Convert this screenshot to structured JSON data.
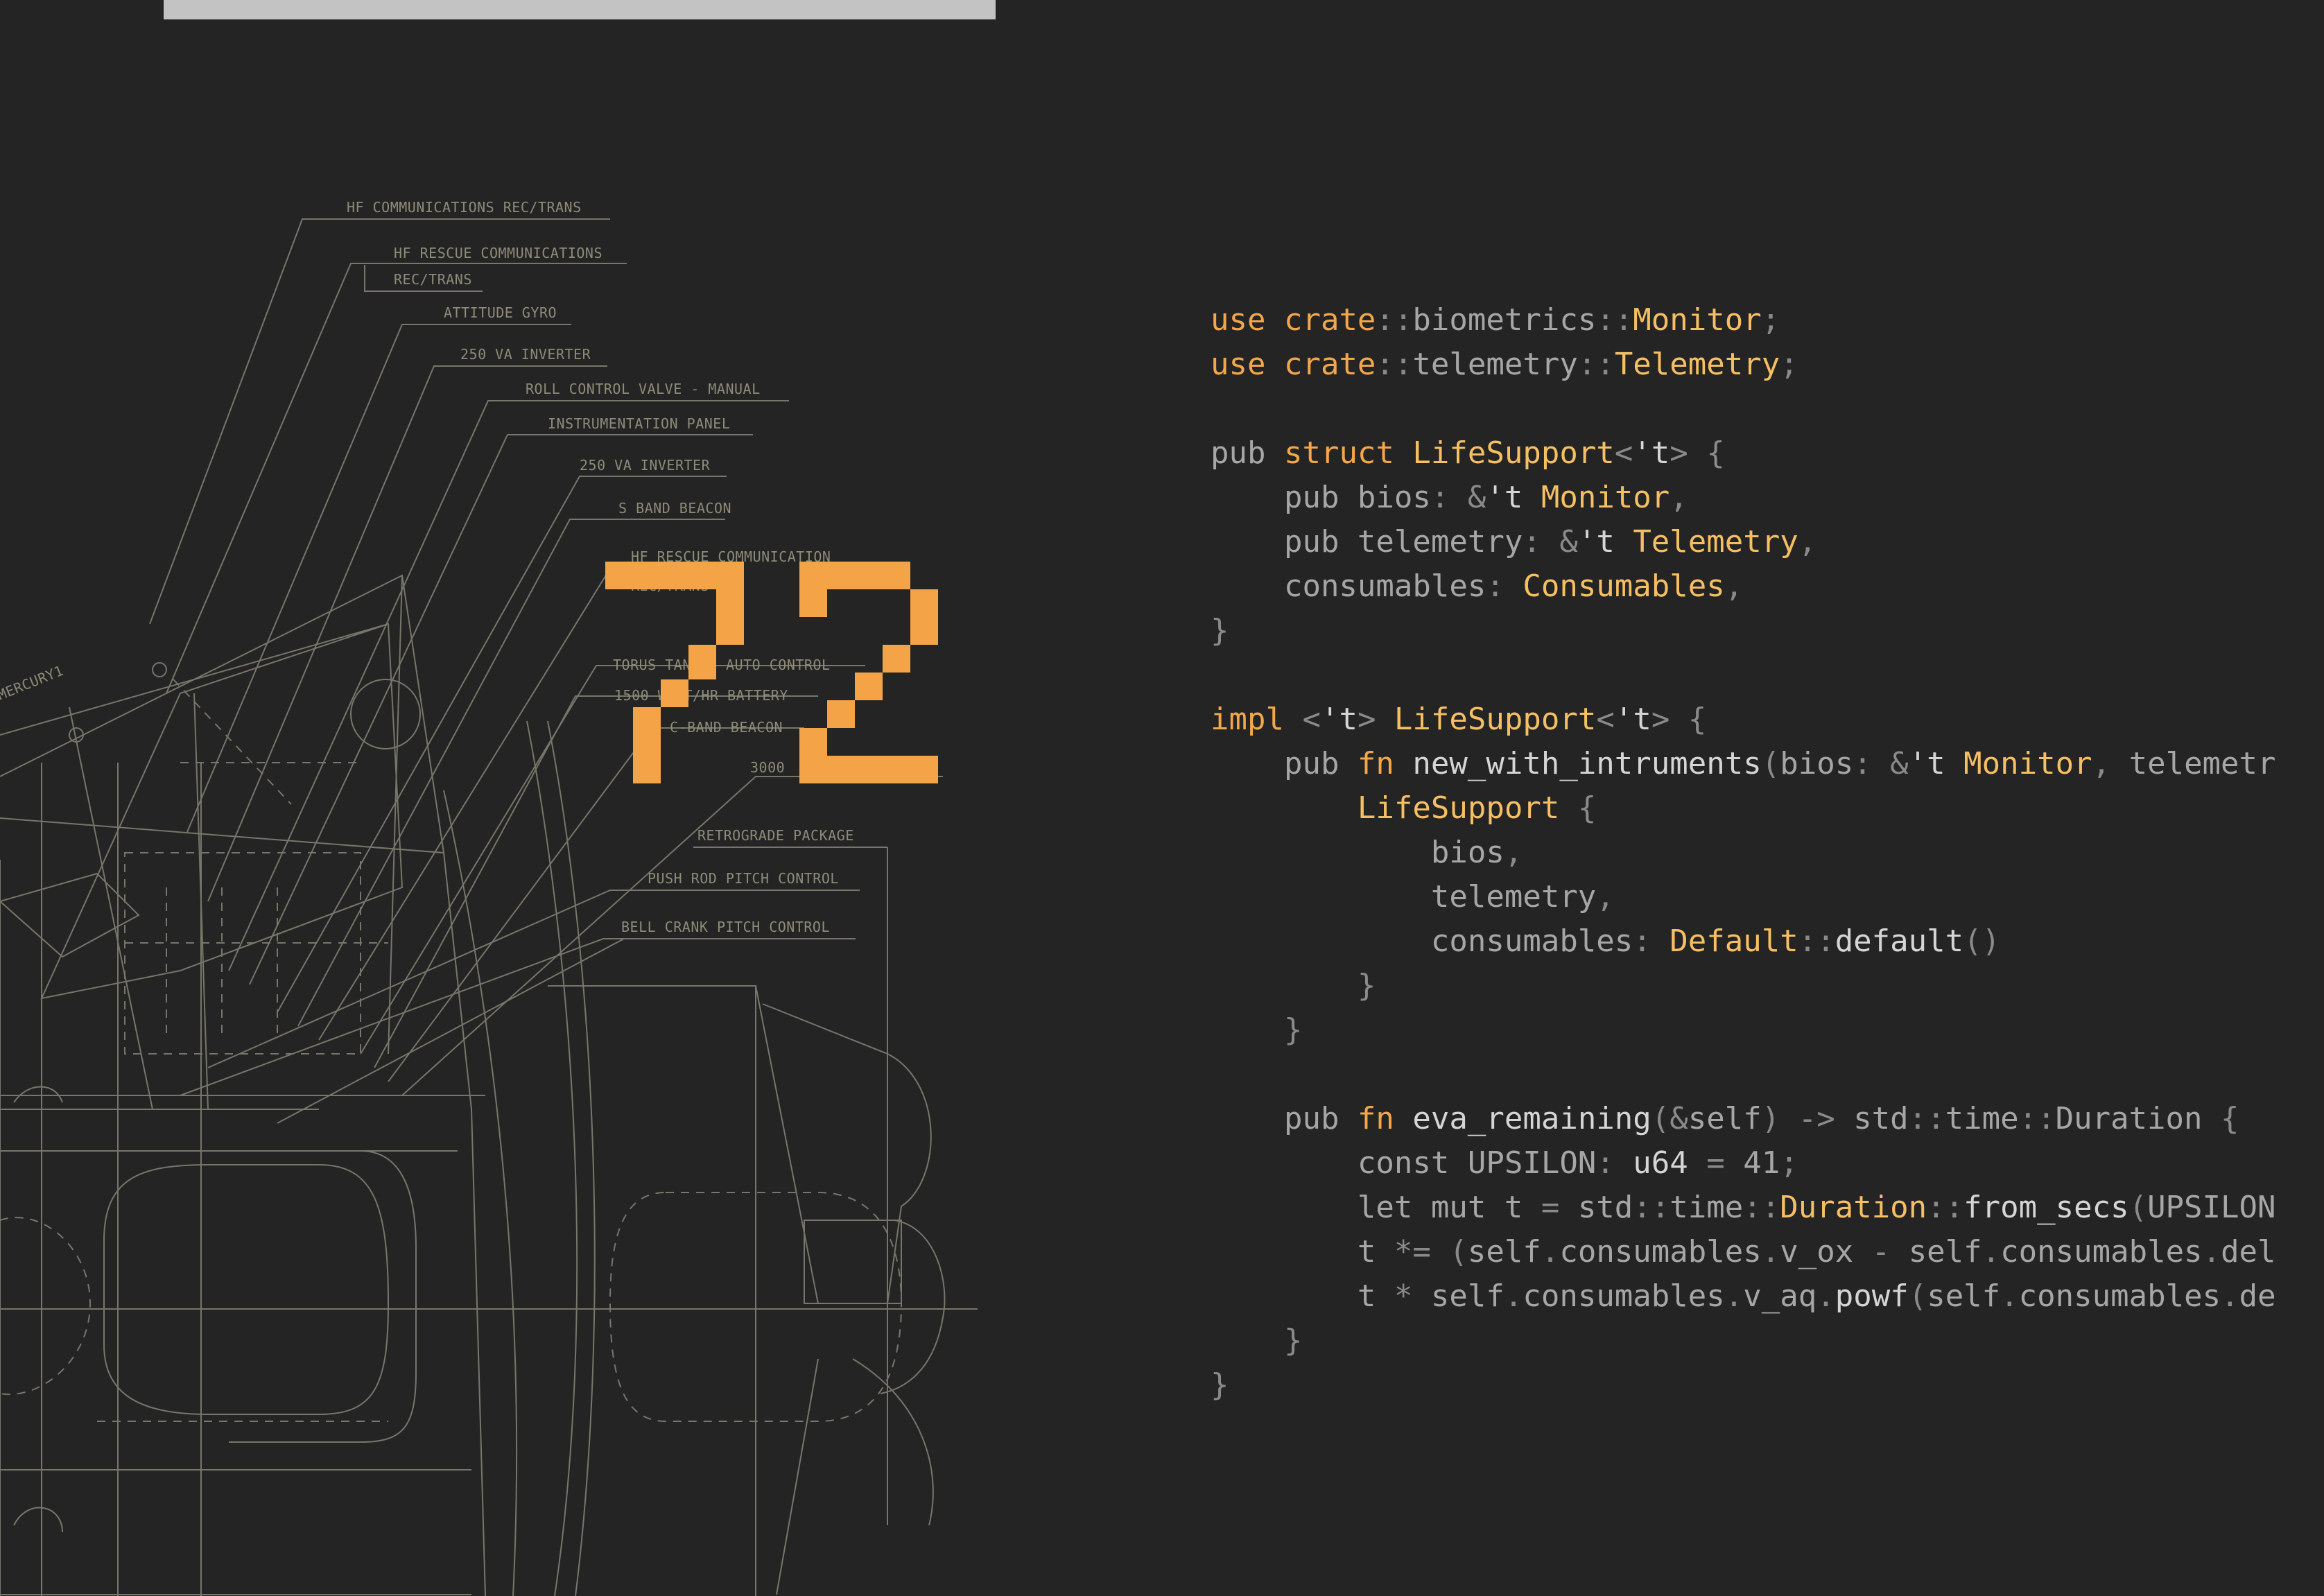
{
  "page": {
    "counter": "72",
    "top_quote_marks": "\" \" \" \""
  },
  "blueprint": {
    "labels": [
      "HF COMMUNICATIONS REC/TRANS",
      "HF RESCUE COMMUNICATIONS",
      "REC/TRANS",
      "ATTITUDE GYRO",
      "250 VA INVERTER",
      "ROLL CONTROL VALVE - MANUAL",
      "INSTRUMENTATION PANEL",
      "250 VA INVERTER",
      "S BAND BEACON",
      "HF RESCUE COMMUNICATION",
      "REC/TRANS",
      "TORUS TANK - AUTO CONTROL",
      "1500 WATT/HR BATTERY",
      "C-BAND BEACON",
      "3000",
      "RETROGRADE PACKAGE",
      "PUSH ROD PITCH CONTROL",
      "BELL CRANK PITCH CONTROL",
      "MERCURY1"
    ]
  },
  "code": {
    "lines": [
      [
        [
          "kw",
          "use "
        ],
        [
          "kw",
          "crate"
        ],
        [
          "pn",
          "::"
        ],
        [
          "tx",
          "biometrics"
        ],
        [
          "pn",
          "::"
        ],
        [
          "ty",
          "Monitor"
        ],
        [
          "pn",
          ";"
        ]
      ],
      [
        [
          "kw",
          "use "
        ],
        [
          "kw",
          "crate"
        ],
        [
          "pn",
          "::"
        ],
        [
          "tx",
          "telemetry"
        ],
        [
          "pn",
          "::"
        ],
        [
          "ty",
          "Telemetry"
        ],
        [
          "pn",
          ";"
        ]
      ],
      [],
      [
        [
          "tx",
          "pub "
        ],
        [
          "kw",
          "struct "
        ],
        [
          "ty",
          "LifeSupport"
        ],
        [
          "pn",
          "<"
        ],
        [
          "fn",
          "'t"
        ],
        [
          "pn",
          "> {"
        ]
      ],
      [
        [
          "tx",
          "    pub bios"
        ],
        [
          "pn",
          ": &"
        ],
        [
          "fn",
          "'t "
        ],
        [
          "ty",
          "Monitor"
        ],
        [
          "pn",
          ","
        ]
      ],
      [
        [
          "tx",
          "    pub telemetry"
        ],
        [
          "pn",
          ": &"
        ],
        [
          "fn",
          "'t "
        ],
        [
          "ty",
          "Telemetry"
        ],
        [
          "pn",
          ","
        ]
      ],
      [
        [
          "tx",
          "    consumables"
        ],
        [
          "pn",
          ": "
        ],
        [
          "ty",
          "Consumables"
        ],
        [
          "pn",
          ","
        ]
      ],
      [
        [
          "pn",
          "}"
        ]
      ],
      [],
      [
        [
          "kw",
          "impl "
        ],
        [
          "pn",
          "<"
        ],
        [
          "fn",
          "'t"
        ],
        [
          "pn",
          "> "
        ],
        [
          "ty",
          "LifeSupport"
        ],
        [
          "pn",
          "<"
        ],
        [
          "fn",
          "'t"
        ],
        [
          "pn",
          "> {"
        ]
      ],
      [
        [
          "tx",
          "    pub "
        ],
        [
          "kw",
          "fn "
        ],
        [
          "fn",
          "new_with_intruments"
        ],
        [
          "pn",
          "("
        ],
        [
          "tx",
          "bios"
        ],
        [
          "pn",
          ": &"
        ],
        [
          "fn",
          "'t "
        ],
        [
          "ty",
          "Monitor"
        ],
        [
          "pn",
          ", "
        ],
        [
          "tx",
          "telemetr"
        ]
      ],
      [
        [
          "tx",
          "        "
        ],
        [
          "ty",
          "LifeSupport"
        ],
        [
          "pn",
          " {"
        ]
      ],
      [
        [
          "tx",
          "            bios"
        ],
        [
          "pn",
          ","
        ]
      ],
      [
        [
          "tx",
          "            telemetry"
        ],
        [
          "pn",
          ","
        ]
      ],
      [
        [
          "tx",
          "            consumables"
        ],
        [
          "pn",
          ": "
        ],
        [
          "ty",
          "Default"
        ],
        [
          "pn",
          "::"
        ],
        [
          "fn",
          "default"
        ],
        [
          "pn",
          "()"
        ]
      ],
      [
        [
          "pn",
          "        }"
        ]
      ],
      [
        [
          "pn",
          "    }"
        ]
      ],
      [],
      [
        [
          "tx",
          "    pub "
        ],
        [
          "kw",
          "fn "
        ],
        [
          "fn",
          "eva_remaining"
        ],
        [
          "pn",
          "(&"
        ],
        [
          "tx",
          "self"
        ],
        [
          "pn",
          ") -> "
        ],
        [
          "tx",
          "std"
        ],
        [
          "pn",
          "::"
        ],
        [
          "tx",
          "time"
        ],
        [
          "pn",
          "::"
        ],
        [
          "tx",
          "Duration"
        ],
        [
          "pn",
          " {"
        ]
      ],
      [
        [
          "tx",
          "        const UPSILON"
        ],
        [
          "pn",
          ": "
        ],
        [
          "fn",
          "u64"
        ],
        [
          "pn",
          " = "
        ],
        [
          "tx",
          "41"
        ],
        [
          "pn",
          ";"
        ]
      ],
      [
        [
          "tx",
          "        let mut t "
        ],
        [
          "pn",
          "= "
        ],
        [
          "tx",
          "std"
        ],
        [
          "pn",
          "::"
        ],
        [
          "tx",
          "time"
        ],
        [
          "pn",
          "::"
        ],
        [
          "ty",
          "Duration"
        ],
        [
          "pn",
          "::"
        ],
        [
          "fn",
          "from_secs"
        ],
        [
          "pn",
          "("
        ],
        [
          "tx",
          "UPSILON"
        ]
      ],
      [
        [
          "tx",
          "        t "
        ],
        [
          "pn",
          "*= ("
        ],
        [
          "tx",
          "self"
        ],
        [
          "pn",
          "."
        ],
        [
          "tx",
          "consumables"
        ],
        [
          "pn",
          "."
        ],
        [
          "tx",
          "v_ox "
        ],
        [
          "pn",
          "- "
        ],
        [
          "tx",
          "self"
        ],
        [
          "pn",
          "."
        ],
        [
          "tx",
          "consumables"
        ],
        [
          "pn",
          "."
        ],
        [
          "tx",
          "del"
        ]
      ],
      [
        [
          "tx",
          "        t "
        ],
        [
          "pn",
          "* "
        ],
        [
          "tx",
          "self"
        ],
        [
          "pn",
          "."
        ],
        [
          "tx",
          "consumables"
        ],
        [
          "pn",
          "."
        ],
        [
          "tx",
          "v_aq"
        ],
        [
          "pn",
          "."
        ],
        [
          "fn",
          "powf"
        ],
        [
          "pn",
          "("
        ],
        [
          "tx",
          "self"
        ],
        [
          "pn",
          "."
        ],
        [
          "tx",
          "consumables"
        ],
        [
          "pn",
          "."
        ],
        [
          "tx",
          "de"
        ]
      ],
      [
        [
          "pn",
          "    }"
        ]
      ],
      [
        [
          "pn",
          "}"
        ]
      ]
    ]
  },
  "colors": {
    "background": "#242424",
    "accent_orange": "#f4a447",
    "type_yellow": "#f6bf63",
    "blueprint_line": "#77766a",
    "code_text": "#a2a2a2",
    "top_bar": "#c3c3c3"
  }
}
